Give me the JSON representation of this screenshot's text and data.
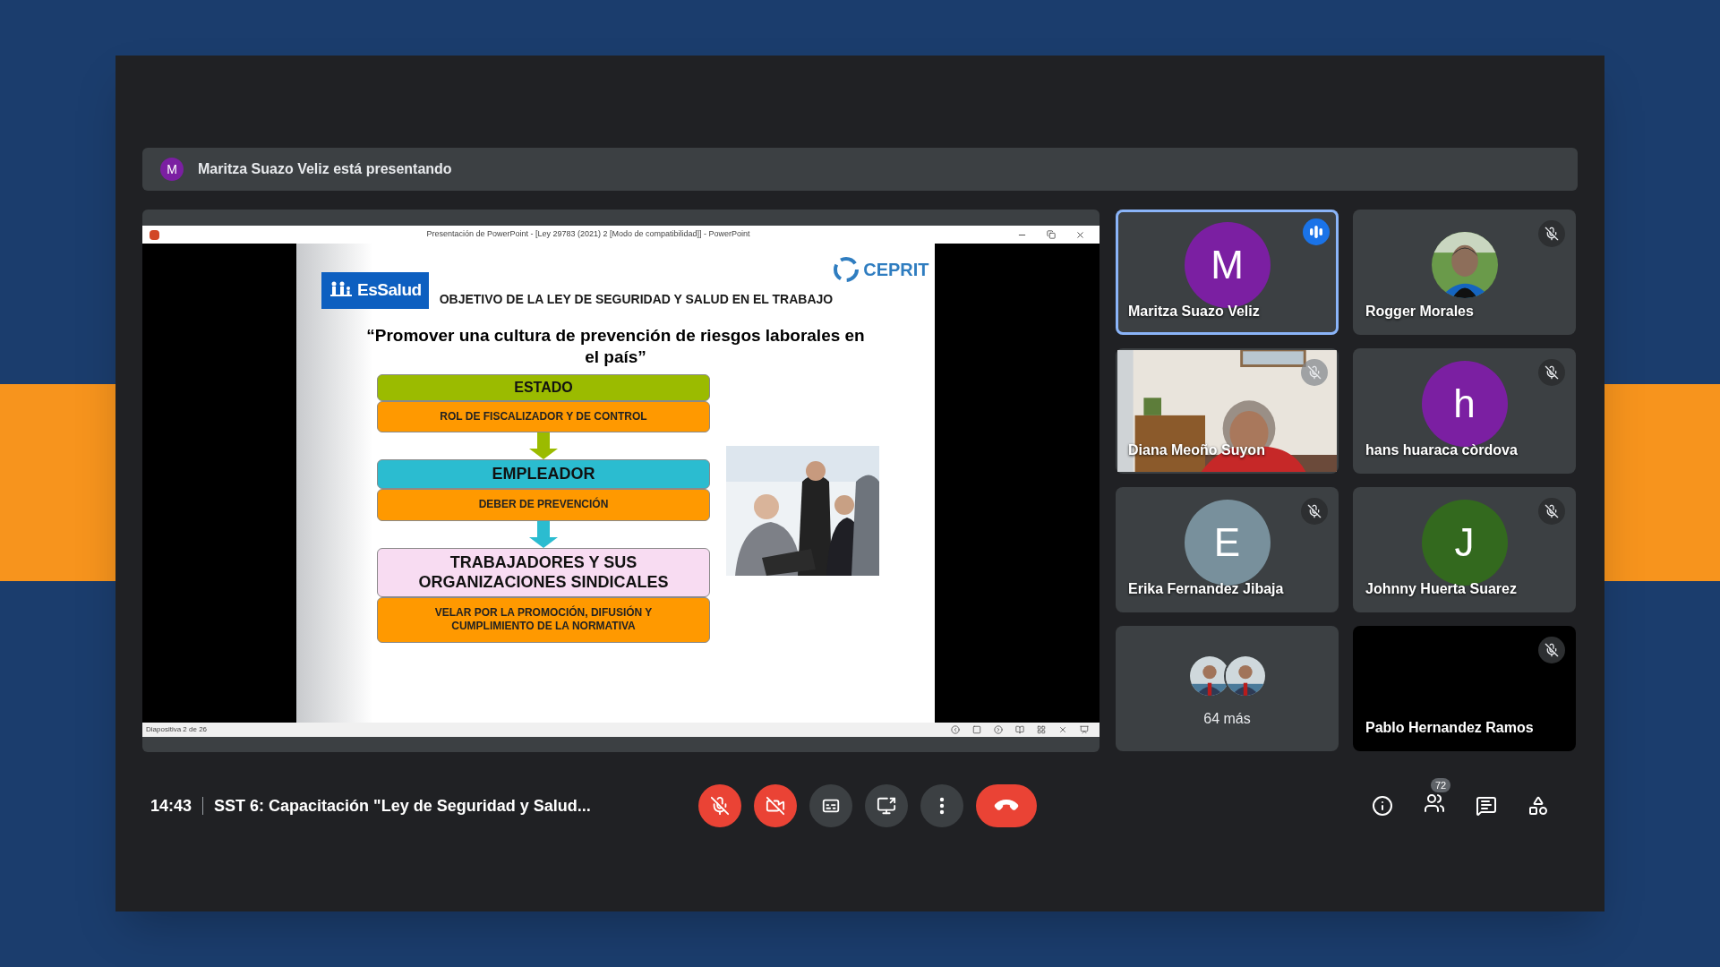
{
  "presenting_bar": {
    "avatar_letter": "M",
    "text": "Maritza Suazo Veliz está presentando"
  },
  "presentation": {
    "window_title": "Presentación de PowerPoint - [Ley 29783 (2021) 2 [Modo de compatibilidad]] - PowerPoint",
    "status_text": "Diapositiva 2 de 26",
    "slide": {
      "logo_left": "EsSalud",
      "logo_right": "CEPRIT",
      "title": "OBJETIVO DE LA LEY DE SEGURIDAD Y SALUD EN EL TRABAJO",
      "quote": "“Promover una cultura de prevención de riesgos laborales en el país”",
      "blocks": [
        {
          "heading": "ESTADO",
          "color": "#9bbb00",
          "detail": "ROL DE FISCALIZADOR Y DE CONTROL"
        },
        {
          "heading": "EMPLEADOR",
          "color": "#2bbcd0",
          "detail": "DEBER DE PREVENCIÓN"
        },
        {
          "heading": "TRABAJADORES Y SUS ORGANIZACIONES SINDICALES",
          "color": "#f8dcf2",
          "detail": "VELAR POR LA PROMOCIÓN, DIFUSIÓN Y CUMPLIMIENTO DE LA NORMATIVA"
        }
      ]
    }
  },
  "tiles": [
    {
      "kind": "avatar",
      "name": "Maritza Suazo Veliz",
      "letter": "M",
      "color": "#7b1fa2",
      "muted": false,
      "speaking": true
    },
    {
      "name": "Rogger Morales",
      "muted": true,
      "speaking": false
    },
    {
      "kind": "video",
      "name": "Diana Meoño Suyon",
      "muted": true,
      "speaking": false
    },
    {
      "kind": "avatar",
      "name": "hans huaraca còrdova",
      "letter": "h",
      "color": "#7b1fa2",
      "muted": true,
      "speaking": false
    },
    {
      "kind": "avatar",
      "name": "Erika Fernandez Jibaja",
      "letter": "E",
      "color": "#78909c",
      "muted": true,
      "speaking": false
    },
    {
      "kind": "avatar",
      "name": "Johnny Huerta Suarez",
      "letter": "J",
      "color": "#33691e",
      "muted": true,
      "speaking": false
    },
    {
      "kind": "more",
      "label": "64 más"
    },
    {
      "kind": "blank",
      "name": "Pablo Hernandez Ramos",
      "muted": true,
      "speaking": false
    }
  ],
  "bottom_bar": {
    "time": "14:43",
    "meeting_title": "SST 6: Capacitación \"Ley de Seguridad y Salud...",
    "controls": [
      {
        "kind": "mic",
        "off": true
      },
      {
        "kind": "camera",
        "off": true
      },
      {
        "kind": "captions",
        "off": false
      },
      {
        "kind": "present",
        "off": false
      },
      {
        "kind": "more",
        "off": false
      },
      {
        "kind": "leave"
      }
    ],
    "people_count": "72"
  }
}
